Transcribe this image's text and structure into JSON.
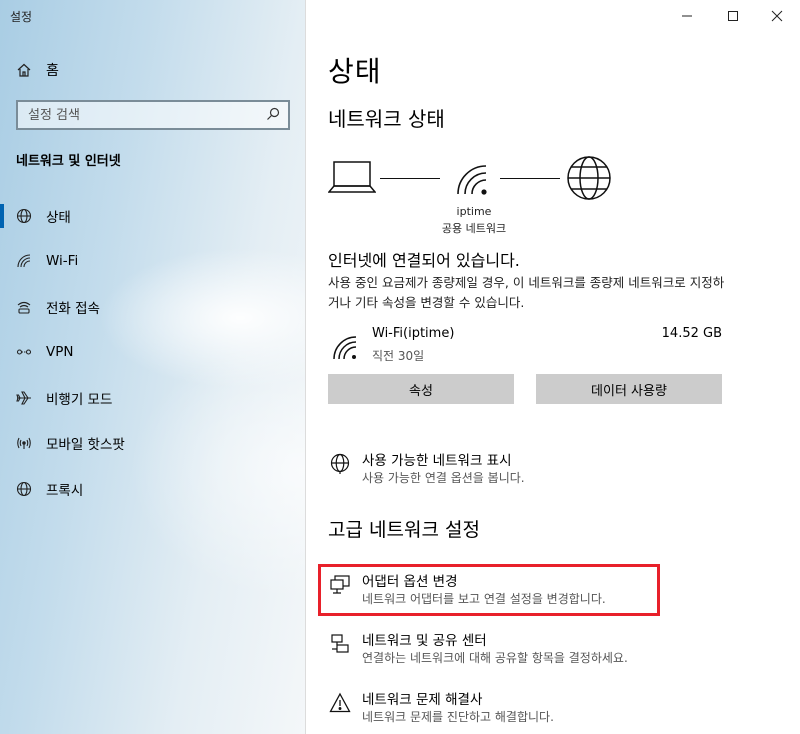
{
  "window": {
    "app_title": "설정",
    "controls": [
      "minimize-icon",
      "maximize-icon",
      "close-icon"
    ]
  },
  "sidebar": {
    "home_label": "홈",
    "search_placeholder": "설정 검색",
    "section_title": "네트워크 및 인터넷",
    "items": [
      {
        "label": "상태",
        "icon": "globe-icon",
        "active": true
      },
      {
        "label": "Wi-Fi",
        "icon": "wifi-icon",
        "active": false
      },
      {
        "label": "전화 접속",
        "icon": "dialup-icon",
        "active": false
      },
      {
        "label": "VPN",
        "icon": "vpn-icon",
        "active": false
      },
      {
        "label": "비행기 모드",
        "icon": "airplane-icon",
        "active": false
      },
      {
        "label": "모바일 핫스팟",
        "icon": "hotspot-icon",
        "active": false
      },
      {
        "label": "프록시",
        "icon": "globe-icon",
        "active": false
      }
    ]
  },
  "main": {
    "title": "상태",
    "network_status_heading": "네트워크 상태",
    "diagram": {
      "network_name": "iptime",
      "network_type": "공용 네트워크"
    },
    "connected_text": "인터넷에 연결되어 있습니다.",
    "description": "사용 중인 요금제가 종량제일 경우, 이 네트워크를 종량제 네트워크로 지정하거나 기타 속성을 변경할 수 있습니다.",
    "connection": {
      "name": "Wi-Fi(iptime)",
      "sub": "직전 30일",
      "usage": "14.52 GB"
    },
    "buttons": {
      "properties": "속성",
      "data_usage": "데이터 사용량"
    },
    "show_networks": {
      "title": "사용 가능한 네트워크 표시",
      "sub": "사용 가능한 연결 옵션을 봅니다."
    },
    "advanced_heading": "고급 네트워크 설정",
    "advanced_links": [
      {
        "title": "어댑터 옵션 변경",
        "sub": "네트워크 어댑터를 보고 연결 설정을 변경합니다.",
        "icon": "adapter-icon"
      },
      {
        "title": "네트워크 및 공유 센터",
        "sub": "연결하는 네트워크에 대해 공유할 항목을 결정하세요.",
        "icon": "sharing-center-icon"
      },
      {
        "title": "네트워크 문제 해결사",
        "sub": "네트워크 문제를 진단하고 해결합니다.",
        "icon": "warning-icon"
      }
    ],
    "highlight_color": "#e8202a",
    "accent_color": "#0063b1"
  }
}
